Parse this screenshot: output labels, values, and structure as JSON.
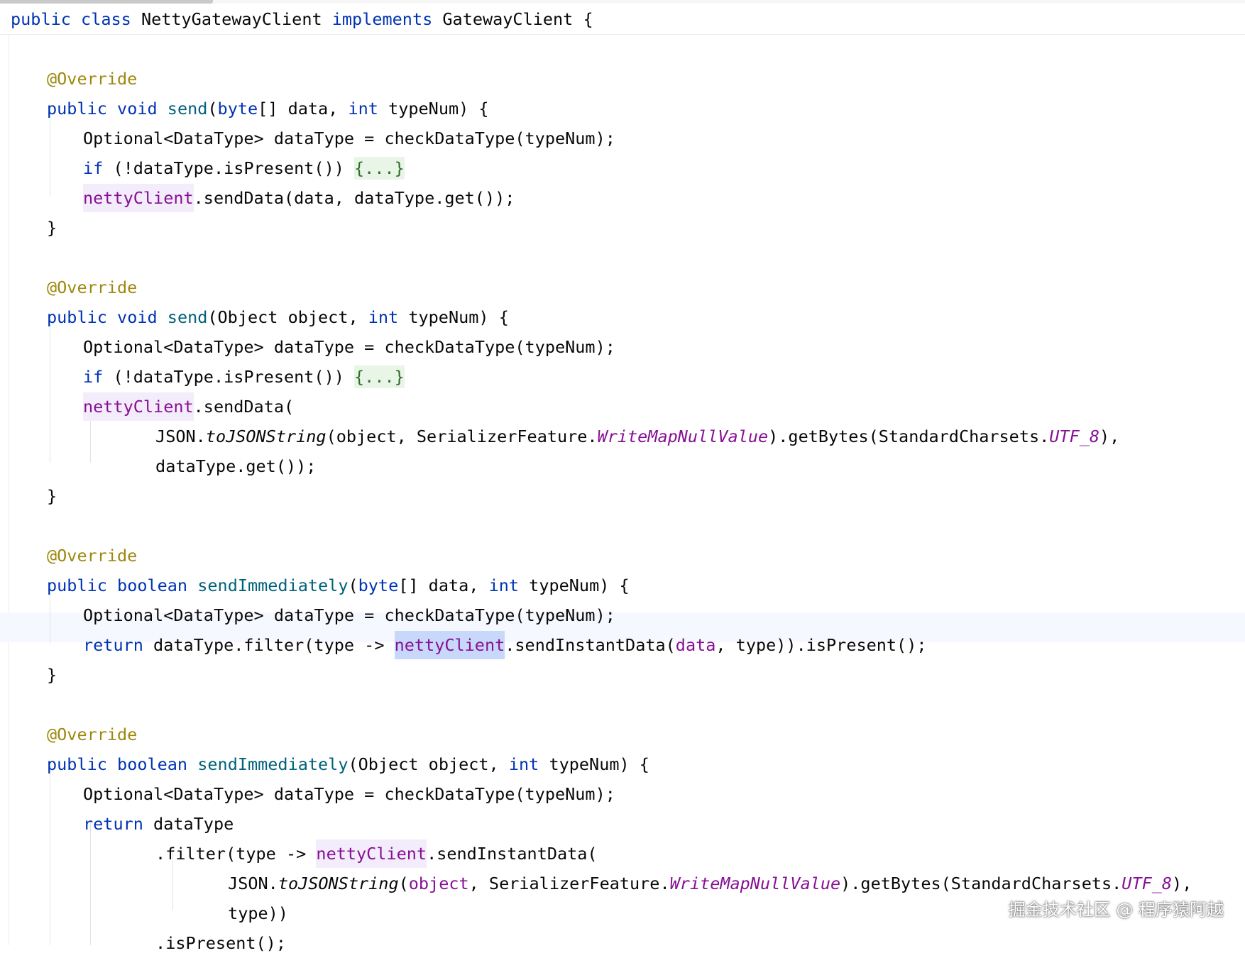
{
  "code_lines": [
    "public class NettyGatewayClient implements GatewayClient {",
    "",
    "    @Override",
    "    public void send(byte[] data, int typeNum) {",
    "        Optional<DataType> dataType = checkDataType(typeNum);",
    "        if (!dataType.isPresent()) {...}",
    "        nettyClient.sendData(data, dataType.get());",
    "    }",
    "",
    "    @Override",
    "    public void send(Object object, int typeNum) {",
    "        Optional<DataType> dataType = checkDataType(typeNum);",
    "        if (!dataType.isPresent()) {...}",
    "        nettyClient.sendData(",
    "                JSON.toJSONString(object, SerializerFeature.WriteMapNullValue).getBytes(StandardCharsets.UTF_8),",
    "                dataType.get());",
    "    }",
    "",
    "    @Override",
    "    public boolean sendImmediately(byte[] data, int typeNum) {",
    "        Optional<DataType> dataType = checkDataType(typeNum);",
    "        return dataType.filter(type -> nettyClient.sendInstantData(data, type)).isPresent();",
    "    }",
    "",
    "    @Override",
    "    public boolean sendImmediately(Object object, int typeNum) {",
    "        Optional<DataType> dataType = checkDataType(typeNum);",
    "        return dataType",
    "                .filter(type -> nettyClient.sendInstantData(",
    "                        JSON.toJSONString(object, SerializerFeature.WriteMapNullValue).getBytes(StandardCharsets.UTF_8),",
    "                        type))",
    "                .isPresent();"
  ],
  "selected_identifier": "nettyClient",
  "watermark": "掘金技术社区 @ 程序猿阿越",
  "colors": {
    "keyword": "#0033b3",
    "annotation": "#9e880d",
    "method_declaration": "#00627a",
    "field": "#871094",
    "fold_highlight": "#e9f5e6",
    "caret_row": "#f5f8fe",
    "selection": "#c8d8fb"
  }
}
